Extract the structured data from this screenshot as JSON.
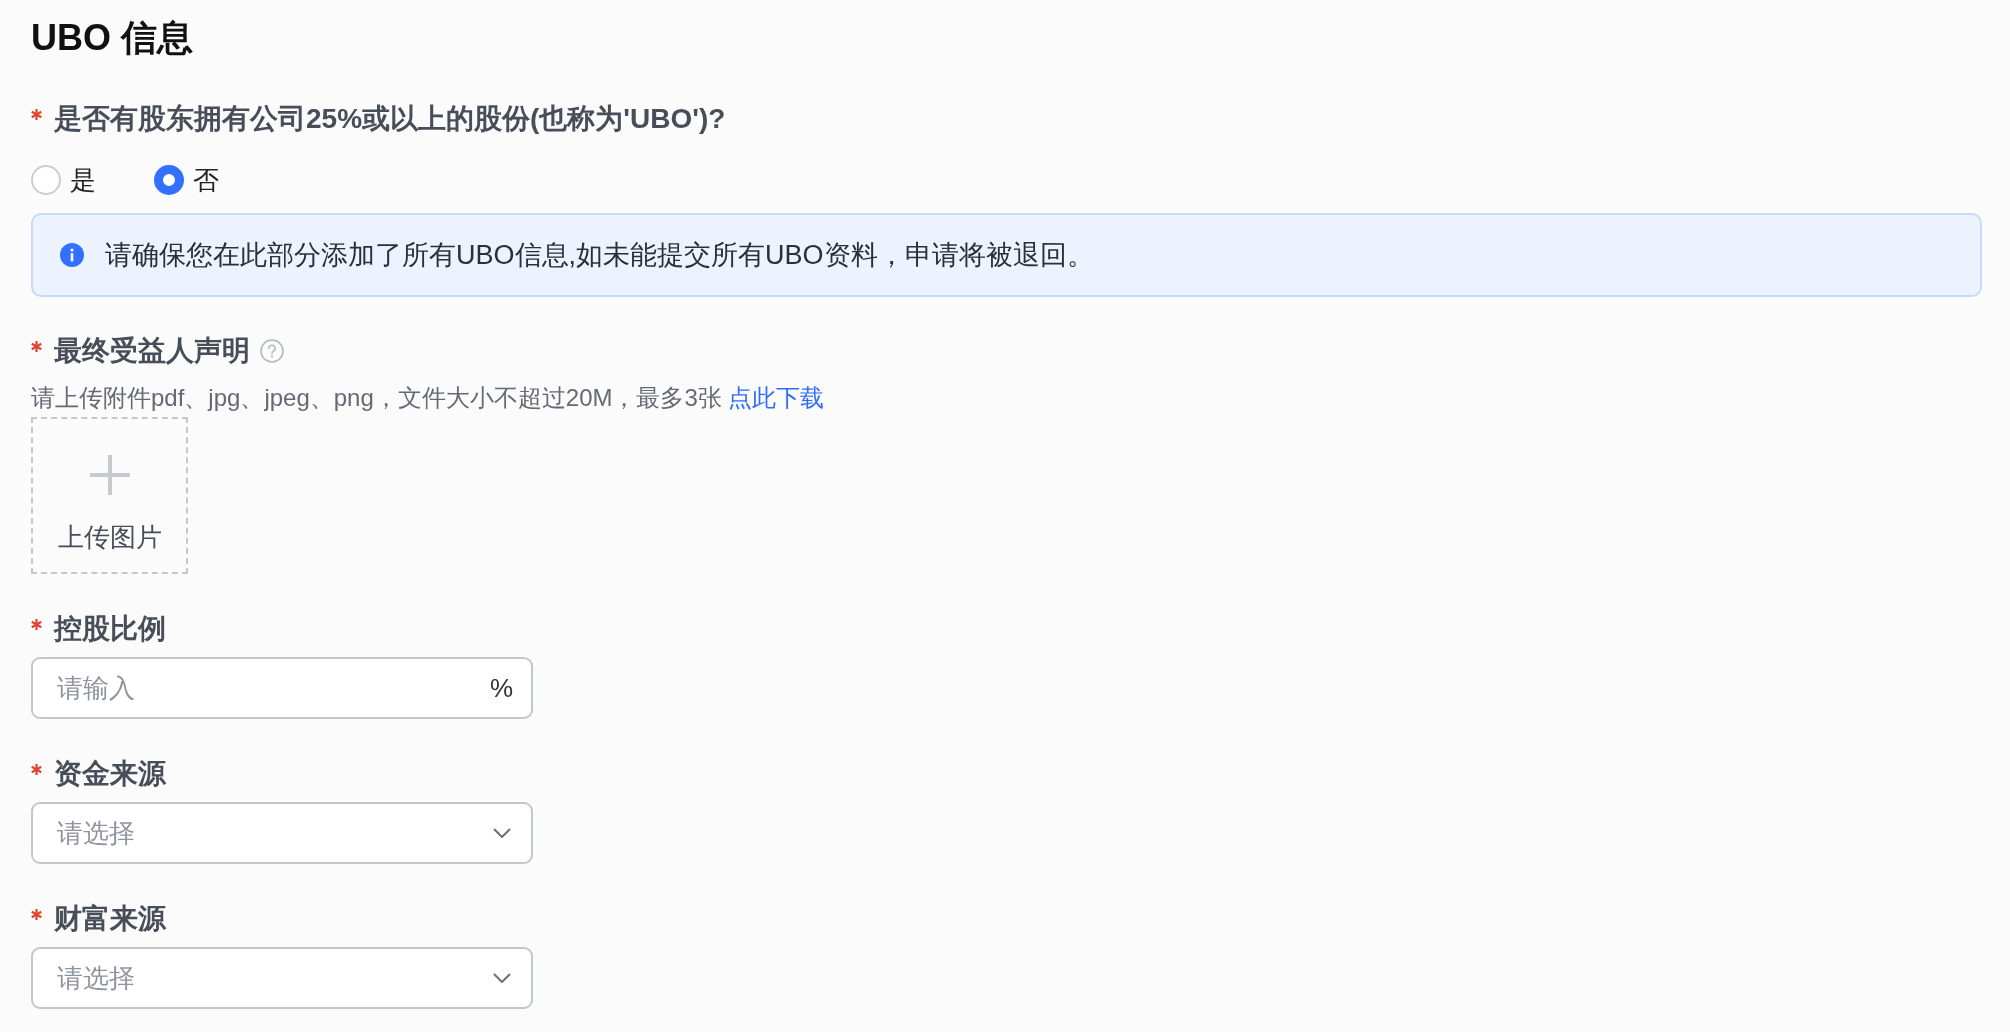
{
  "title": "UBO 信息",
  "ubo_question": {
    "label": "是否有股东拥有公司25%或以上的股份(也称为'UBO')?",
    "required": true,
    "options": [
      {
        "label": "是",
        "selected": false
      },
      {
        "label": "否",
        "selected": true
      }
    ]
  },
  "alert": {
    "text": "请确保您在此部分添加了所有UBO信息,如未能提交所有UBO资料，申请将被退回。"
  },
  "declaration": {
    "label": "最终受益人声明",
    "required": true,
    "hint": "请上传附件pdf、jpg、jpeg、png，文件大小不超过20M，最多3张",
    "link": "点此下载",
    "upload_label": "上传图片"
  },
  "fields": [
    {
      "kind": "input",
      "label": "控股比例",
      "required": true,
      "placeholder": "请输入",
      "suffix": "%"
    },
    {
      "kind": "select",
      "label": "资金来源",
      "required": true,
      "placeholder": "请选择"
    },
    {
      "kind": "select",
      "label": "财富来源",
      "required": true,
      "placeholder": "请选择"
    }
  ]
}
